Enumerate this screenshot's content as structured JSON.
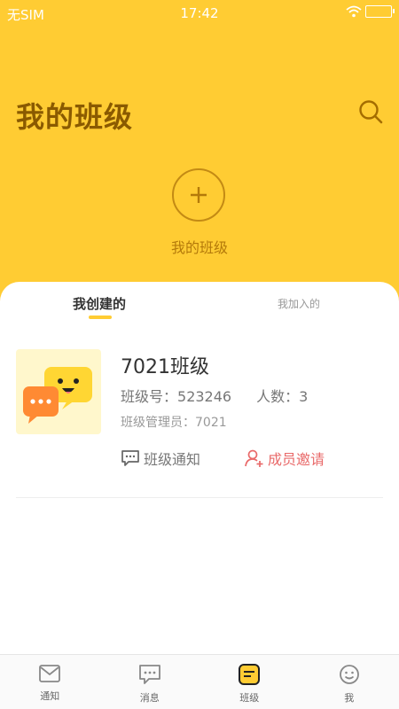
{
  "status_bar": {
    "carrier": "无SIM",
    "time": "17:42"
  },
  "header": {
    "title": "我的班级",
    "create_label": "我的班级"
  },
  "tabs": [
    {
      "label": "我创建的",
      "active": true
    },
    {
      "label": "我加入的",
      "active": false
    }
  ],
  "class_item": {
    "name": "7021班级",
    "class_no_label": "班级号：",
    "class_no": "523246",
    "member_label": "人数：",
    "member_count": "3",
    "admin_label": "班级管理员：",
    "admin": "7021",
    "notice_action": "班级通知",
    "invite_action": "成员邀请"
  },
  "bottom_nav": [
    {
      "label": "通知",
      "icon": "envelope-icon"
    },
    {
      "label": "消息",
      "icon": "chat-icon"
    },
    {
      "label": "班级",
      "icon": "class-icon",
      "active": true
    },
    {
      "label": "我",
      "icon": "smiley-icon"
    }
  ],
  "colors": {
    "accent": "#ffcc33",
    "title": "#8a5a00",
    "invite": "#e96a6a"
  }
}
